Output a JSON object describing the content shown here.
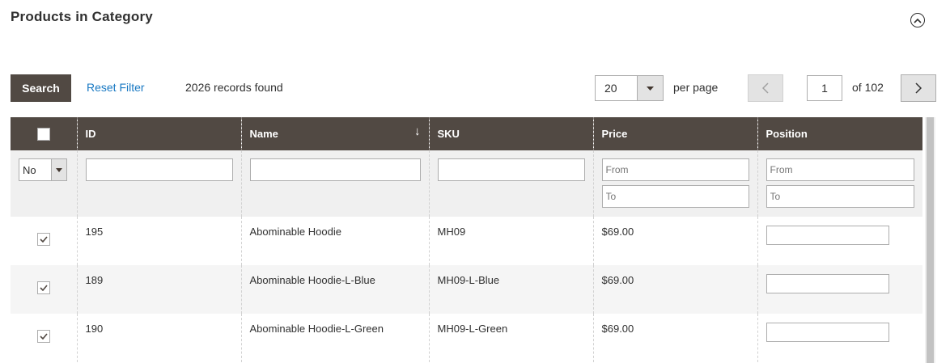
{
  "section": {
    "title": "Products in Category",
    "collapse_icon": "chevron-up-circle-icon"
  },
  "toolbar": {
    "search_label": "Search",
    "reset_label": "Reset Filter",
    "records_text": "2026 records found",
    "per_page_value": "20",
    "per_page_label": "per page",
    "current_page": "1",
    "page_of": "of 102"
  },
  "grid": {
    "columns": [
      {
        "key": "select",
        "label": ""
      },
      {
        "key": "id",
        "label": "ID"
      },
      {
        "key": "name",
        "label": "Name",
        "sort": "↓"
      },
      {
        "key": "sku",
        "label": "SKU"
      },
      {
        "key": "price",
        "label": "Price"
      },
      {
        "key": "position",
        "label": "Position"
      }
    ],
    "filters": {
      "in_category": "No",
      "price_from_placeholder": "From",
      "price_to_placeholder": "To",
      "position_from_placeholder": "From",
      "position_to_placeholder": "To"
    },
    "rows": [
      {
        "id": "195",
        "name": "Abominable Hoodie",
        "sku": "MH09",
        "price": "$69.00",
        "checked": true
      },
      {
        "id": "189",
        "name": "Abominable Hoodie-L-Blue",
        "sku": "MH09-L-Blue",
        "price": "$69.00",
        "checked": true
      },
      {
        "id": "190",
        "name": "Abominable Hoodie-L-Green",
        "sku": "MH09-L-Green",
        "price": "$69.00",
        "checked": true
      }
    ]
  },
  "colors": {
    "header_bg": "#514943",
    "link": "#1979c3",
    "filter_bg": "#f0f0f0"
  }
}
